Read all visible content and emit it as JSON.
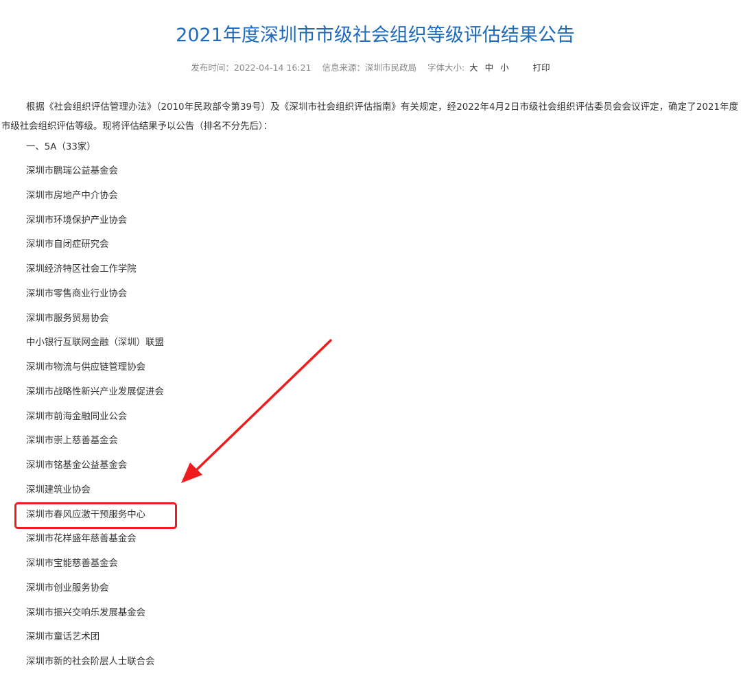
{
  "article": {
    "title": "2021年度深圳市市级社会组织等级评估结果公告",
    "meta": {
      "published": "发布时间：2022-04-14 16:21",
      "source": "信息来源：深圳市民政局",
      "font_size_label": "字体大小:",
      "size_large": "大",
      "size_medium": "中",
      "size_small": "小",
      "print": "打印"
    },
    "intro": "根据《社会组织评估管理办法》（2010年民政部令第39号）及《深圳市社会组织评估指南》有关规定，经2022年4月2日市级社会组织评估委员会会议评定，确定了2021年度市级社会组织评估等级。现将评估结果予以公告（排名不分先后）：",
    "section_heading": "一、5A（33家）",
    "organizations": [
      "深圳市鹏瑞公益基金会",
      "深圳市房地产中介协会",
      "深圳市环境保护产业协会",
      "深圳市自闭症研究会",
      "深圳经济特区社会工作学院",
      "深圳市零售商业行业协会",
      "深圳市服务贸易协会",
      "中小银行互联网金融（深圳）联盟",
      "深圳市物流与供应链管理协会",
      "深圳市战略性新兴产业发展促进会",
      "深圳市前海金融同业公会",
      "深圳市崇上慈善基金会",
      "深圳市铭基金公益基金会",
      "深圳建筑业协会",
      "深圳市春风应激干预服务中心",
      "深圳市花样盛年慈善基金会",
      "深圳市宝能慈善基金会",
      "深圳市创业服务协会",
      "深圳市振兴交响乐发展基金会",
      "深圳市童话艺术团",
      "深圳市新的社会阶层人士联合会"
    ]
  },
  "annotation": {
    "highlight_color": "#ee1c1c",
    "highlighted_item_index": 14
  },
  "colors": {
    "title": "#1e6bbd",
    "text": "#333333",
    "meta": "#888888"
  }
}
